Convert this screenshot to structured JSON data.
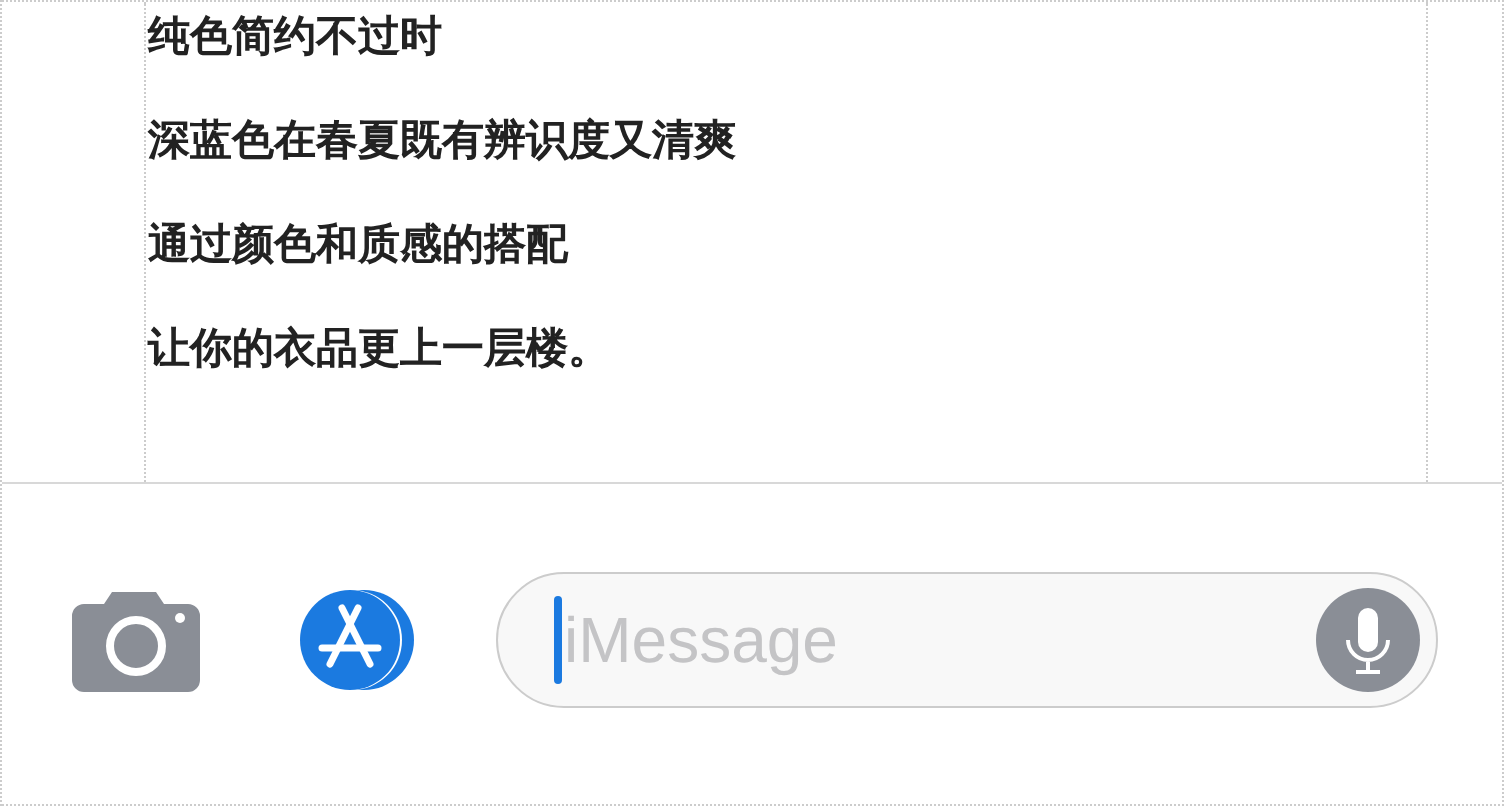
{
  "message_lines": [
    "纯色简约不过时",
    "深蓝色在春夏既有辨识度又清爽",
    "通过颜色和质感的搭配",
    "让你的衣品更上一层楼。"
  ],
  "input": {
    "placeholder": "iMessage"
  }
}
